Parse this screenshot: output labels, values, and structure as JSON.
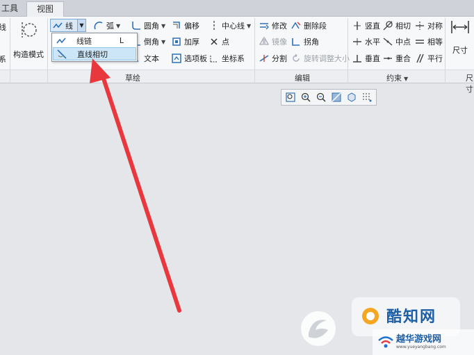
{
  "tabs": [
    {
      "label": "工具"
    },
    {
      "label": "视图"
    }
  ],
  "left_clip": {
    "line1": "线",
    "line2": "系"
  },
  "construct_mode": {
    "label": "构造模式"
  },
  "sketch": {
    "line": "线",
    "arc": "弧",
    "fillet": "圆角",
    "offset": "偏移",
    "centerline": "中心线",
    "chamfer": "倒角",
    "thicken": "加厚",
    "point": "点",
    "text": "文本",
    "palette": "选项板",
    "coordsys": "坐标系",
    "group_label": "草绘"
  },
  "line_dropdown": {
    "items": [
      {
        "label": "线链",
        "shortcut": "L"
      },
      {
        "label": "直线相切",
        "shortcut": ""
      }
    ]
  },
  "edit": {
    "modify": "修改",
    "delete_segment": "删除段",
    "mirror": "镜像",
    "corner": "拐角",
    "divide": "分割",
    "rotate_resize": "旋转调整大小",
    "group_label": "编辑"
  },
  "constrain": {
    "vertical": "竖直",
    "tangent": "相切",
    "symmetric": "对称",
    "horizontal": "水平",
    "midpoint": "中点",
    "equal": "相等",
    "perpendicular": "垂直",
    "coincident": "重合",
    "parallel": "平行",
    "group_label": "约束"
  },
  "dimension": {
    "label": "尺寸",
    "group_label": "尺寸"
  },
  "watermarks": {
    "site1": "酷知网",
    "site2": "越华游戏网",
    "url": "www.yueyangbang.com"
  },
  "colors": {
    "accent": "#2f6fb5",
    "arrow": "#e8383d",
    "canvas": "#e4e6ea"
  }
}
